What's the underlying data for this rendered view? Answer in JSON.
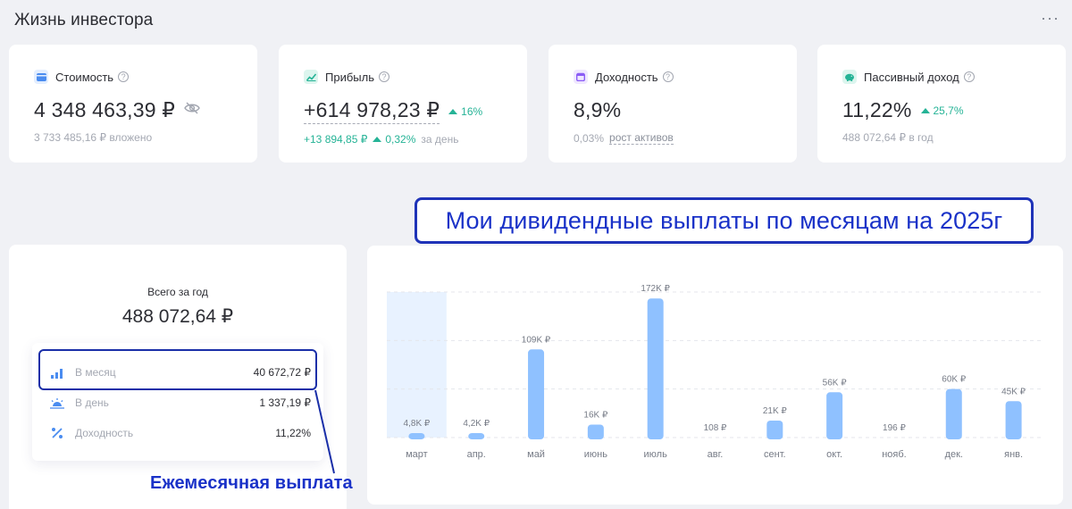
{
  "header": {
    "title": "Жизнь инвестора",
    "more_label": "···"
  },
  "stats": [
    {
      "label": "Стоимость",
      "value": "4 348 463,39 ₽",
      "sub": "3 733 485,16 ₽ вложено",
      "icon": "wallet-icon",
      "icon_color": "#4a8cf0",
      "icon_bg": "#e3eeff"
    },
    {
      "label": "Прибыль",
      "value": "+614 978,23 ₽",
      "badge": "16%",
      "sub_change": "+13 894,85 ₽",
      "sub_percent": "0,32%",
      "sub_suffix": "за день",
      "icon": "trend-icon",
      "icon_color": "#25b396",
      "icon_bg": "#dcf5ee"
    },
    {
      "label": "Доходность",
      "value": "8,9%",
      "sub_percent": "0,03%",
      "sub_link": "рост активов",
      "icon": "calendar-icon",
      "icon_color": "#8b5cf6",
      "icon_bg": "#efe7ff"
    },
    {
      "label": "Пассивный доход",
      "value": "11,22%",
      "badge": "25,7%",
      "sub": "488 072,64 ₽ в год",
      "icon": "piggy-bank-icon",
      "icon_color": "#25b396",
      "icon_bg": "#dcf5ee"
    }
  ],
  "summary": {
    "title": "Всего за год",
    "total": "488 072,64 ₽",
    "rows": [
      {
        "label": "В месяц",
        "value": "40 672,72 ₽",
        "icon": "bar-chart-icon"
      },
      {
        "label": "В день",
        "value": "1 337,19 ₽",
        "icon": "sunrise-icon"
      },
      {
        "label": "Доходность",
        "value": "11,22%",
        "icon": "percent-icon"
      }
    ]
  },
  "annotations": {
    "banner": "Мои дивидендные выплаты по месяцам на 2025г",
    "monthly_caption": "Ежемесячная выплата"
  },
  "colors": {
    "accent": "#25b396",
    "bar": "#8fc1ff",
    "annotation_blue": "#1a32c8"
  },
  "chart_data": {
    "type": "bar",
    "categories": [
      "март",
      "апр.",
      "май",
      "июнь",
      "июль",
      "авг.",
      "сент.",
      "окт.",
      "нояб.",
      "дек.",
      "янв."
    ],
    "values": [
      4800,
      4200,
      109000,
      16000,
      172000,
      108,
      21000,
      56000,
      196,
      60000,
      45000
    ],
    "labels": [
      "4,8K ₽",
      "4,2K ₽",
      "109K ₽",
      "16K ₽",
      "172K ₽",
      "108 ₽",
      "21K ₽",
      "56K ₽",
      "196 ₽",
      "60K ₽",
      "45K ₽"
    ],
    "highlighted_index": 0,
    "ylim": [
      0,
      180000
    ],
    "grid": true
  }
}
